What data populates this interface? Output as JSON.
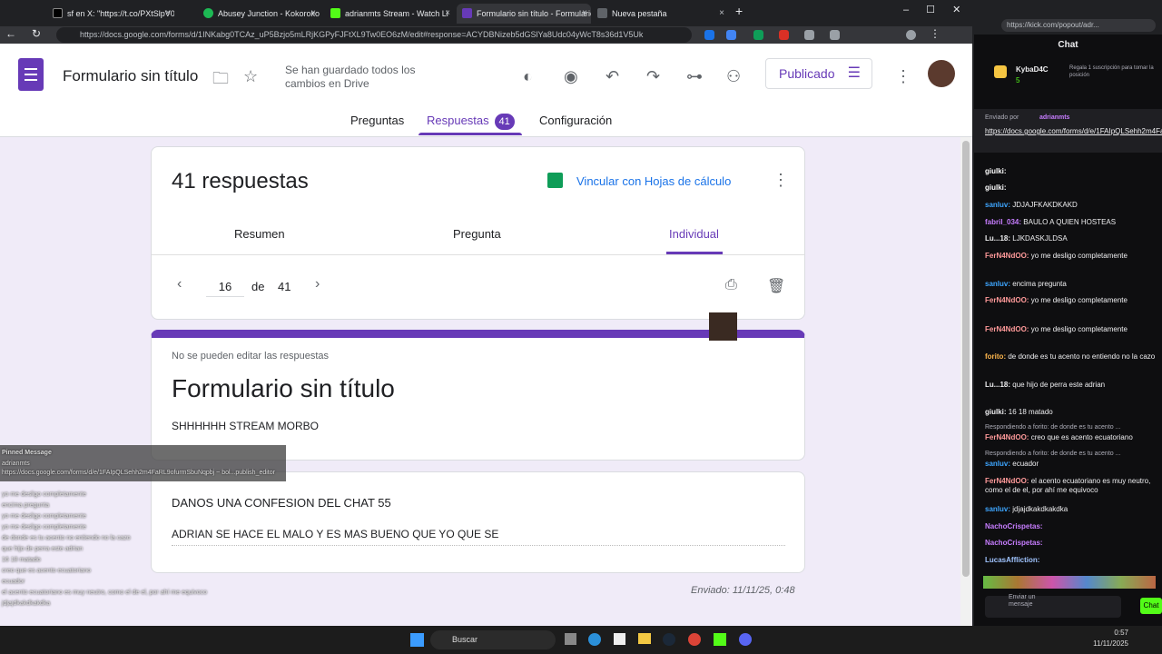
{
  "browser": {
    "tabs": [
      {
        "label": "sf en X: \"https://t.co/PXtSlpV0AU\""
      },
      {
        "label": "Abusey Junction - Kokoroko"
      },
      {
        "label": "adrianmts Stream - Watch Li"
      },
      {
        "label": "Formulario sin título - Formulario"
      },
      {
        "label": "Nueva pestaña"
      }
    ],
    "url": "https://docs.google.com/forms/d/1INKabg0TCAz_uP5Bzjo5mLRjKGPyFJFtXL9Tw0EO6zM/edit#response=ACYDBNizeb5dGSlYa8Udc04yWcT8s36d1V5Uk"
  },
  "forms": {
    "title": "Formulario sin título",
    "save_status": "Se han guardado todos los cambios en Drive",
    "publish_label": "Publicado",
    "tabs": {
      "questions": "Preguntas",
      "responses": "Respuestas",
      "responses_count": "41",
      "settings": "Configuración"
    },
    "summary": {
      "count_label": "41 respuestas",
      "link_sheets": "Vincular con Hojas de cálculo",
      "subtabs": {
        "summary": "Resumen",
        "question": "Pregunta",
        "individual": "Individual"
      },
      "pager": {
        "current": "16",
        "of": "de",
        "total": "41"
      }
    },
    "response_header": {
      "notice": "No se pueden editar las respuestas",
      "title": "Formulario sin título",
      "description": "SHHHHHH STREAM MORBO"
    },
    "question": {
      "title": "DANOS UNA CONFESION DEL CHAT 55",
      "answer": "ADRIAN SE HACE EL MALO Y ES MAS BUENO QUE YO QUE SE"
    },
    "submitted": "Enviado: 11/11/25, 0:48"
  },
  "chat": {
    "url": "https://kick.com/popout/adr...",
    "title": "Chat",
    "top_user": "KybaD4C",
    "top_user_count": "5",
    "gift_text": "Regala 1 suscripción para tomar la posición",
    "gift_count": "2",
    "pinned_by": "Enviado por",
    "pinned_user": "adrianmts",
    "pinned_link": "https://docs.google.com/forms/d/e/1FAIpQLSehh2m4FaRL9ofurmSbuNqp...",
    "messages": [
      {
        "user": "giulki:",
        "text": "",
        "color": "#ffffff"
      },
      {
        "user": "giulki:",
        "text": "",
        "color": "#ffffff"
      },
      {
        "user": "sanluv:",
        "text": "JDJAJFKAKDKAKD",
        "color": "#3ea6ff"
      },
      {
        "user": "fabril_034:",
        "text": "BAULO A QUIEN HOSTEAS",
        "color": "#c77dff"
      },
      {
        "user": "Lu...18:",
        "text": "LJKDASKJLDSA",
        "color": "#ffffff"
      },
      {
        "user": "FerN4NdOO:",
        "text": "yo me desligo completamente",
        "color": "#ff9a9a"
      },
      {
        "user": "sanluv:",
        "text": "encima pregunta",
        "color": "#3ea6ff"
      },
      {
        "user": "FerN4NdOO:",
        "text": "yo me desligo completamente",
        "color": "#ff9a9a"
      },
      {
        "user": "FerN4NdOO:",
        "text": "yo me desligo completamente",
        "color": "#ff9a9a"
      },
      {
        "user": "forito:",
        "text": "de donde es tu acento no entiendo no la cazo",
        "color": "#ffb74d"
      },
      {
        "user": "Lu...18:",
        "text": "que hijo de perra este adrian",
        "color": "#ffffff"
      },
      {
        "user": "giulki:",
        "text": "16 18 matado",
        "color": "#ffffff"
      },
      {
        "user": "FerN4NdOO:",
        "text": "creo que es acento ecuatoriano",
        "color": "#ff9a9a"
      },
      {
        "user": "sanluv:",
        "text": "ecuador",
        "color": "#3ea6ff"
      },
      {
        "user": "FerN4NdOO:",
        "text": "el acento ecuatoriano es muy neutro, como el de el, por ahí me equivoco",
        "color": "#ff9a9a"
      },
      {
        "user": "sanluv:",
        "text": "jdjajdkakdkakdka",
        "color": "#3ea6ff"
      },
      {
        "user": "NachoCrispetas:",
        "text": "",
        "color": "#c77dff"
      },
      {
        "user": "NachoCrispetas:",
        "text": "",
        "color": "#c77dff"
      },
      {
        "user": "LucasAffliction:",
        "text": "",
        "color": "#a0c4ff"
      }
    ],
    "reply_1": "Respondiendo a forito: de donde es tu acento ...",
    "reply_2": "Respondiendo a forito: de donde es tu acento ...",
    "send_placeholder": "Enviar un mensaje",
    "send_button": "Chat"
  },
  "overlay": {
    "pinned_title": "Pinned Message",
    "pinned_user": "adrianmts",
    "pinned_link": "https://docs.google.com/forms/d/e/1FAIpQLSehh2m4FaRL9ofurmSbuNqpbj ~ bol...publish_editor"
  },
  "taskbar": {
    "search": "Buscar",
    "time": "0:57",
    "date": "11/11/2025"
  }
}
